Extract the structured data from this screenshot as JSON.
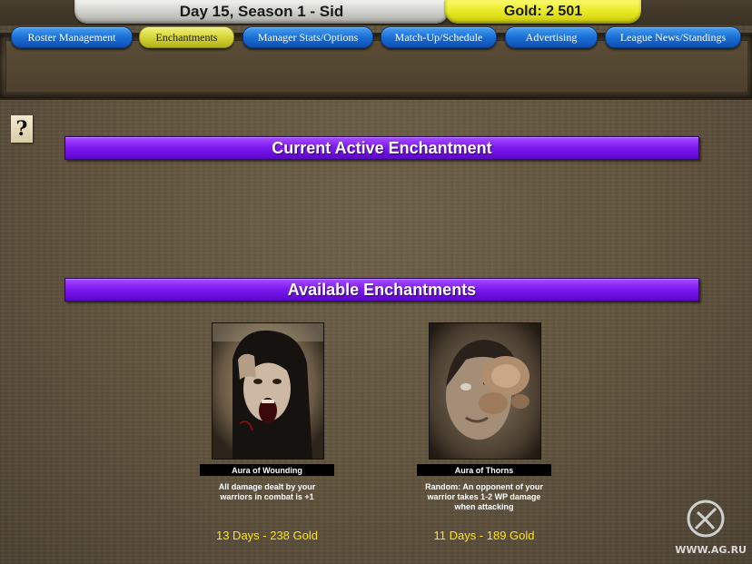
{
  "header": {
    "day_label": "Day 15, Season 1 - Sid",
    "gold_label": "Gold: 2 501"
  },
  "nav": {
    "items": [
      {
        "label": "Roster Management",
        "active": false
      },
      {
        "label": "Enchantments",
        "active": true
      },
      {
        "label": "Manager Stats/Options",
        "active": false
      },
      {
        "label": "Match-Up/Schedule",
        "active": false
      },
      {
        "label": "Advertising",
        "active": false
      },
      {
        "label": "League News/Standings",
        "active": false
      }
    ]
  },
  "help": {
    "glyph": "?"
  },
  "sections": {
    "current_title": "Current Active Enchantment",
    "available_title": "Available Enchantments"
  },
  "enchantments": [
    {
      "name": "Aura of Wounding",
      "description_lines": [
        "All damage dealt by your",
        "warriors in combat is +1"
      ],
      "price": "13 Days - 238 Gold",
      "image_icon": "screaming-face-portrait"
    },
    {
      "name": "Aura of Thorns",
      "description_lines": [
        "Random: An opponent of your",
        "warrior takes 1-2 WP damage",
        "when attacking"
      ],
      "price": "11 Days - 189 Gold",
      "image_icon": "fungus-face-portrait"
    }
  ],
  "watermark": {
    "text": "WWW.AG.RU"
  },
  "colors": {
    "nav_blue": "#1a6fd6",
    "nav_active_yellow": "#d2d233",
    "section_purple": "#7a18f0",
    "price_yellow": "#ffe21a",
    "gold_pill": "#e6e61e"
  }
}
